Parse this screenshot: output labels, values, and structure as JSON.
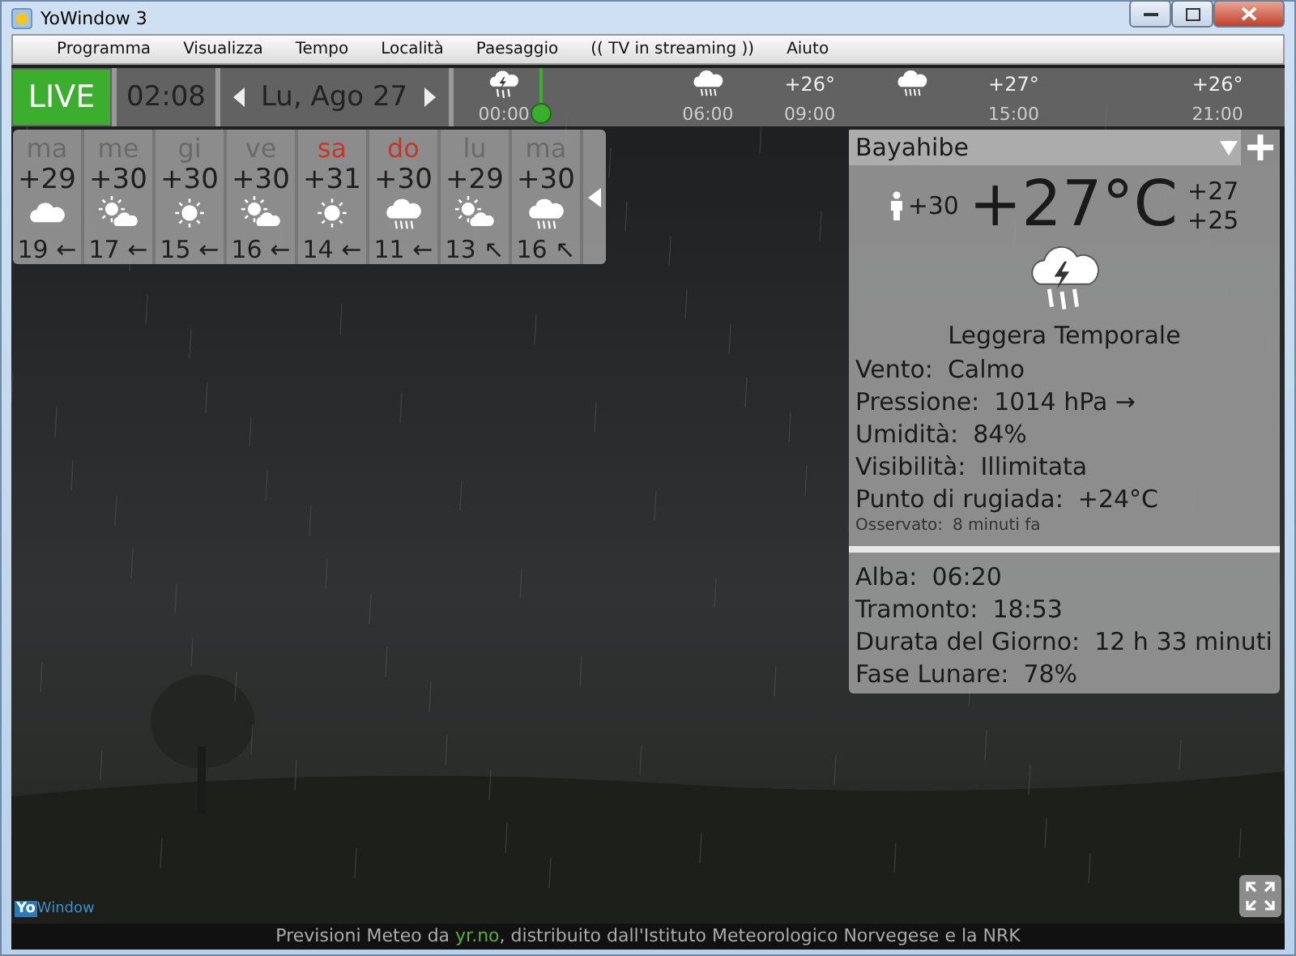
{
  "window": {
    "title": "YoWindow 3"
  },
  "menu": [
    "Programma",
    "Visualizza",
    "Tempo",
    "Località",
    "Paesaggio",
    "(( TV in streaming ))",
    "Aiuto"
  ],
  "topbar": {
    "live": "LIVE",
    "time": "02:08",
    "date": "Lu, Ago 27"
  },
  "timeline": [
    {
      "kind": "storm",
      "time": "00:00"
    },
    {
      "kind": "rain",
      "time": "06:00"
    },
    {
      "kind": "temp",
      "temp": "+26°",
      "time": "09:00"
    },
    {
      "kind": "rain"
    },
    {
      "kind": "temp",
      "temp": "+27°",
      "time": "15:00"
    },
    {
      "kind": "temp",
      "temp": "+26°",
      "time": "21:00"
    }
  ],
  "forecast": [
    {
      "day": "ma",
      "weekend": false,
      "temp": "+29",
      "kind": "cloud",
      "wind": "19",
      "arrow": "←"
    },
    {
      "day": "me",
      "weekend": false,
      "temp": "+30",
      "kind": "sun-cloud",
      "wind": "17",
      "arrow": "←"
    },
    {
      "day": "gi",
      "weekend": false,
      "temp": "+30",
      "kind": "sun",
      "wind": "15",
      "arrow": "←"
    },
    {
      "day": "ve",
      "weekend": false,
      "temp": "+30",
      "kind": "sun-cloud",
      "wind": "16",
      "arrow": "←"
    },
    {
      "day": "sa",
      "weekend": true,
      "temp": "+31",
      "kind": "sun",
      "wind": "14",
      "arrow": "←"
    },
    {
      "day": "do",
      "weekend": true,
      "temp": "+30",
      "kind": "rain",
      "wind": "11",
      "arrow": "←"
    },
    {
      "day": "lu",
      "weekend": false,
      "temp": "+29",
      "kind": "sun-cloud",
      "wind": "13",
      "arrow": "↖"
    },
    {
      "day": "ma",
      "weekend": false,
      "temp": "+30",
      "kind": "rain",
      "wind": "16",
      "arrow": "↖"
    }
  ],
  "current": {
    "location": "Bayahibe",
    "feels_like": "+30",
    "temperature": "+27°C",
    "high": "+27",
    "low": "+25",
    "kind": "storm",
    "condition": "Leggera Temporale",
    "details": [
      {
        "label": "Vento:",
        "value": "Calmo"
      },
      {
        "label": "Pressione:",
        "value": "1014 hPa →"
      },
      {
        "label": "Umidità:",
        "value": "84%"
      },
      {
        "label": "Visibilità:",
        "value": "Illimitata"
      },
      {
        "label": "Punto di rugiada:",
        "value": "+24°C"
      }
    ],
    "observed": {
      "label": "Osservato:",
      "value": "8 minuti fa"
    },
    "astro": [
      {
        "label": "Alba:",
        "value": "06:20"
      },
      {
        "label": "Tramonto:",
        "value": "18:53"
      },
      {
        "label": "Durata del Giorno:",
        "value": "12 h 33 minuti"
      },
      {
        "label": "Fase Lunare:",
        "value": "78%"
      }
    ]
  },
  "logo": {
    "part_1": "Yo",
    "part_2": "Window"
  },
  "credits": {
    "before": "Previsioni Meteo da ",
    "link": "yr.no",
    "after": ", distribuito dall'Istituto Meteorologico Norvegese e la NRK"
  }
}
